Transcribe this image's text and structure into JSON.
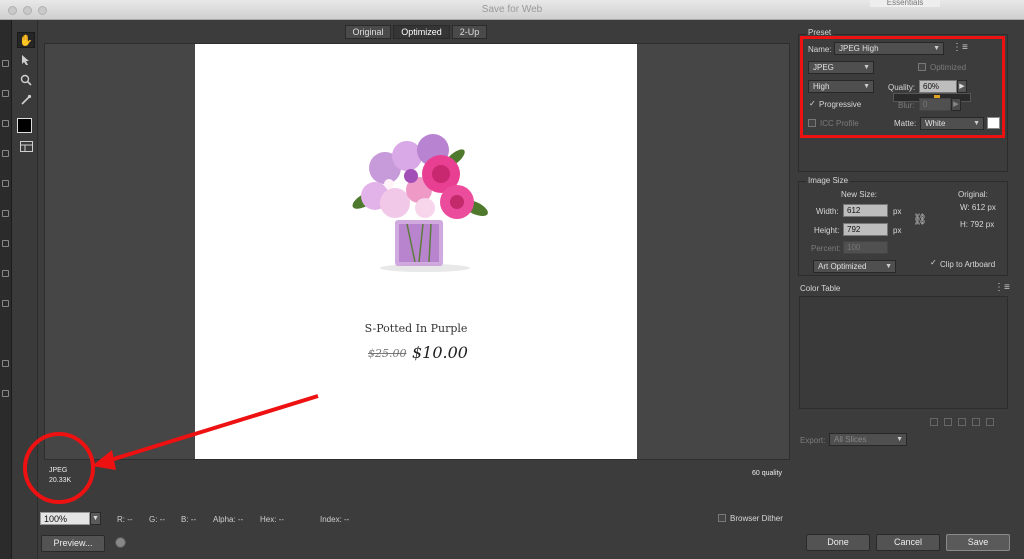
{
  "window": {
    "title": "Save for Web",
    "background_tab": "Essentials"
  },
  "view_tabs": [
    {
      "label": "Original"
    },
    {
      "label": "Optimized"
    },
    {
      "label": "2-Up"
    }
  ],
  "preview": {
    "product_name": "S-Potted In Purple",
    "old_price": "$25.00",
    "new_price": "$10.00",
    "format": "JPEG",
    "file_size": "20.33K",
    "quality_note": "60 quality"
  },
  "bottom": {
    "zoom": "100%",
    "r": "R: --",
    "g": "G: --",
    "b": "B: --",
    "alpha": "Alpha: --",
    "hex": "Hex: --",
    "index": "Index: --",
    "browser_dither": "Browser Dither",
    "preview_btn": "Preview...",
    "done_btn": "Done",
    "cancel_btn": "Cancel",
    "save_btn": "Save"
  },
  "preset": {
    "section": "Preset",
    "name_label": "Name:",
    "name_value": "JPEG High",
    "format": "JPEG",
    "optimized": "Optimized",
    "quality_level": "High",
    "quality_label": "Quality:",
    "quality_value": "60%",
    "progressive": "Progressive",
    "blur_label": "Blur:",
    "blur_value": "0",
    "icc_profile": "ICC Profile",
    "matte_label": "Matte:",
    "matte_value": "White"
  },
  "image_size": {
    "section": "Image Size",
    "new_size": "New Size:",
    "original": "Original:",
    "width_label": "Width:",
    "width_value": "612",
    "height_label": "Height:",
    "height_value": "792",
    "px": "px",
    "orig_w": "W: 612 px",
    "orig_h": "H: 792 px",
    "percent_label": "Percent:",
    "percent_value": "100",
    "resample": "Art Optimized",
    "clip": "Clip to Artboard"
  },
  "color_table": {
    "section": "Color Table"
  },
  "export": {
    "label": "Export:",
    "value": "All Slices"
  },
  "colors": {
    "annotation_red": "#ee1111",
    "panel_bg": "#3c3c3c"
  }
}
